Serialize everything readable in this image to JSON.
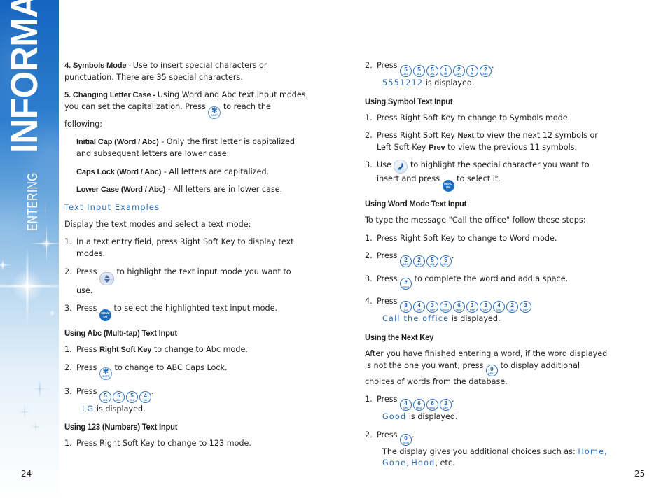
{
  "sidebar": {
    "title_small": "ENTERING",
    "title_big": "INFORMATION",
    "accent_color": "#1565c0"
  },
  "pages": {
    "left_number": "24",
    "right_number": "25"
  },
  "left_column": {
    "item4": {
      "heading": "4. Symbols Mode - ",
      "body": "Use to insert special characters or punctuation. There are 35 special characters."
    },
    "item5": {
      "heading": "5. Changing Letter Case - ",
      "body_part1": "Using Word and Abc text input modes, you can set the capitalization. Press ",
      "body_part2": " to reach the following:"
    },
    "definitions": [
      {
        "term": "Initial Cap (Word / Abc)",
        "desc": " - Only the first letter is capitalized and subsequent letters are lower case."
      },
      {
        "term": "Caps Lock (Word / Abc)",
        "desc": " - All letters are capitalized."
      },
      {
        "term": "Lower Case (Word / Abc)",
        "desc": " - All letters are in lower case."
      }
    ],
    "examples_heading": "Text Input Examples",
    "examples_intro": "Display the text modes and select a text mode:",
    "steps": [
      {
        "num": "1.",
        "text": "In a text entry field, press Right Soft Key to display text modes."
      },
      {
        "num": "2.",
        "pre": "Press ",
        "post": " to highlight the text input mode you want to use."
      },
      {
        "num": "3.",
        "pre": "Press ",
        "post": " to select the highlighted text input mode."
      }
    ],
    "abc_heading": "Using Abc (Multi-tap) Text Input",
    "abc_steps": {
      "s1_num": "1.",
      "s1_pre": "Press ",
      "s1_bold": "Right Soft Key",
      "s1_post": " to change to Abc mode.",
      "s2_num": "2.",
      "s2_pre": "Press ",
      "s2_post": " to change to ABC Caps Lock.",
      "s3_num": "3.",
      "s3_pre": "Press ",
      "s3_post": ".",
      "s3_keys": [
        {
          "number": "5",
          "letters": "JKL"
        },
        {
          "number": "5",
          "letters": "JKL"
        },
        {
          "number": "5",
          "letters": "JKL"
        },
        {
          "number": "4",
          "letters": "GHI"
        }
      ],
      "result_value": "LG",
      "result_suffix": " is displayed."
    },
    "num123_heading": "Using 123 (Numbers) Text Input",
    "num123_step1_num": "1.",
    "num123_step1": "Press Right Soft Key to change to 123 mode."
  },
  "right_column": {
    "num123_step2_num": "2.",
    "num123_step2_pre": "Press ",
    "num123_step2_post": ".",
    "num123_keys": [
      {
        "number": "5",
        "letters": "JKL"
      },
      {
        "number": "5",
        "letters": "JKL"
      },
      {
        "number": "5",
        "letters": "JKL"
      },
      {
        "number": "1",
        "letters": "✉"
      },
      {
        "number": "2",
        "letters": "ABC"
      },
      {
        "number": "1",
        "letters": "✉"
      },
      {
        "number": "2",
        "letters": "ABC"
      }
    ],
    "num123_result_value": "5551212",
    "num123_result_suffix": " is displayed.",
    "symbol_heading": "Using Symbol Text Input",
    "symbol_steps": [
      {
        "num": "1.",
        "text": "Press Right Soft Key to change to Symbols mode."
      }
    ],
    "symbol_step2_num": "2.",
    "symbol_step2_a": "Press Right Soft Key ",
    "symbol_step2_b": "Next",
    "symbol_step2_c": " to view the next 12 symbols or Left Soft Key ",
    "symbol_step2_d": "Prev",
    "symbol_step2_e": " to view the previous 11 symbols.",
    "symbol_step3_num": "3.",
    "symbol_step3_a": "Use ",
    "symbol_step3_b": " to highlight the special character you want to insert and press ",
    "symbol_step3_c": " to select it.",
    "word_heading": "Using Word Mode Text Input",
    "word_intro": "To type the message \"Call the office\" follow these steps:",
    "word_step1_num": "1.",
    "word_step1": "Press Right Soft Key to change to Word mode.",
    "word_step2_num": "2.",
    "word_step2_pre": "Press ",
    "word_step2_post": ".",
    "word_step2_keys": [
      {
        "number": "2",
        "letters": "ABC"
      },
      {
        "number": "2",
        "letters": "ABC"
      },
      {
        "number": "5",
        "letters": "JKL"
      },
      {
        "number": "5",
        "letters": "JKL"
      }
    ],
    "word_step3_num": "3.",
    "word_step3_pre": "Press ",
    "word_step3_post": " to complete the word and add a space.",
    "word_step4_num": "4.",
    "word_step4_pre": "Press ",
    "word_step4_keys": [
      {
        "number": "8",
        "letters": "TUV"
      },
      {
        "number": "4",
        "letters": "GHI"
      },
      {
        "number": "3",
        "letters": "DEF"
      },
      {
        "number": "#",
        "letters": "SPACE"
      },
      {
        "number": "6",
        "letters": "MNO"
      },
      {
        "number": "3",
        "letters": "DEF"
      },
      {
        "number": "3",
        "letters": "DEF"
      },
      {
        "number": "4",
        "letters": "GHI"
      },
      {
        "number": "2",
        "letters": "ABC"
      },
      {
        "number": "3",
        "letters": "DEF"
      }
    ],
    "word_result_value": "Call the office",
    "word_result_suffix": " is displayed.",
    "next_heading": "Using the Next Key",
    "next_intro_a": "After you have finished entering a word, if the word displayed is not the one you want, press ",
    "next_intro_b": " to display additional choices of words from the database.",
    "next_step1_num": "1.",
    "next_step1_pre": "Press ",
    "next_step1_post": ".",
    "next_step1_keys": [
      {
        "number": "4",
        "letters": "GHI"
      },
      {
        "number": "6",
        "letters": "MNO"
      },
      {
        "number": "6",
        "letters": "MNO"
      },
      {
        "number": "3",
        "letters": "DEF"
      }
    ],
    "next_result_value": "Good",
    "next_result_suffix": " is displayed.",
    "next_step2_num": "2.",
    "next_step2_pre": "Press ",
    "next_step2_post": ".",
    "next_choices_pre": "The display gives you additional choices such as: ",
    "next_choices_v1": "Home",
    "next_choices_sep1": ", ",
    "next_choices_v2": "Gone",
    "next_choices_sep2": ", ",
    "next_choices_v3": "Hood",
    "next_choices_end": ", etc."
  },
  "keys": {
    "shift": {
      "glyph": "✻",
      "label": "SHIFT"
    },
    "menu_ok": {
      "line1": "MENU",
      "line2": "OK"
    },
    "zero_next": {
      "number": "0",
      "letters": "NEXT"
    },
    "hash_space": {
      "number": "#",
      "letters": "SPACE"
    }
  }
}
